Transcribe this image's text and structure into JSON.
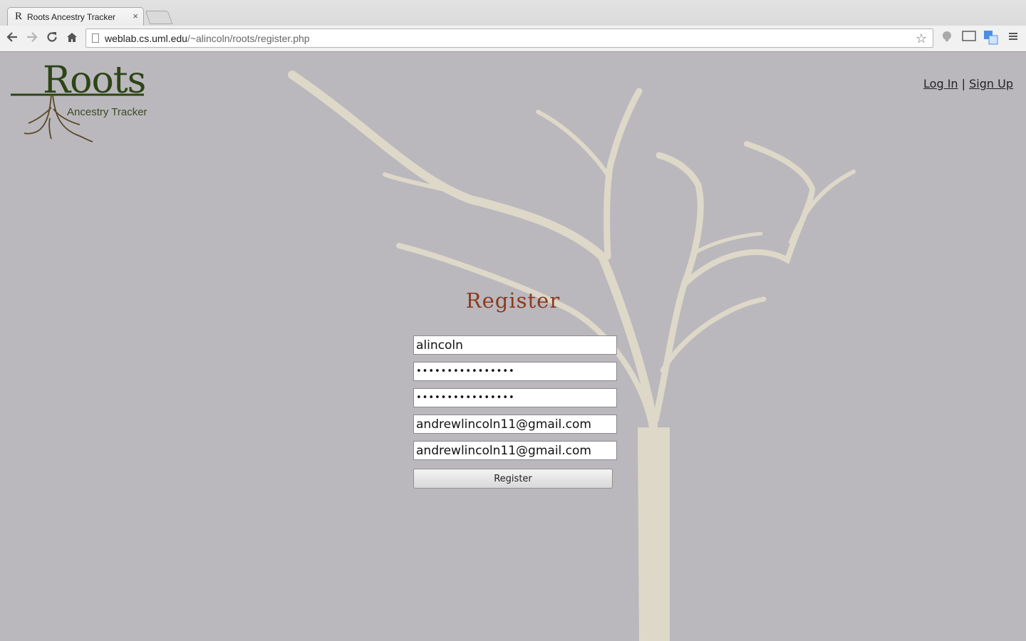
{
  "browser": {
    "tab_favicon": "R",
    "tab_title": "Roots Ancestry Tracker",
    "tab_close": "×",
    "url_host": "weblab.cs.uml.edu",
    "url_path": "/~alincoln/roots/register.php",
    "icons": [
      "back-icon",
      "forward-icon",
      "reload-icon",
      "home-icon",
      "star-icon",
      "extension-icon",
      "cast-icon",
      "translate-icon",
      "menu-icon"
    ]
  },
  "header": {
    "logo_title": "Roots",
    "logo_subtitle": "Ancestry Tracker",
    "login_link": "Log In",
    "separator": "|",
    "signup_link": "Sign Up"
  },
  "form": {
    "title": "Register",
    "username": "alincoln",
    "password": "••••••••••••••••",
    "confirm_password": "••••••••••••••••",
    "email": "andrewlincoln11@gmail.com",
    "confirm_email": "andrewlincoln11@gmail.com",
    "submit_label": "Register"
  },
  "colors": {
    "page_background": "#bab8bd",
    "tree": "#ddd8c8",
    "logo_green": "#2d4516",
    "title_brown": "#8b3a1f"
  }
}
